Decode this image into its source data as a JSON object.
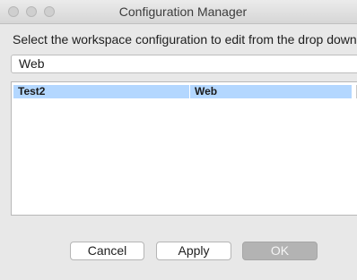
{
  "window": {
    "title": "Configuration Manager"
  },
  "instruction": "Select the workspace configuration to edit from the drop down l",
  "workspace_select": {
    "value": "Web"
  },
  "table": {
    "rows": [
      {
        "col1": "Test2",
        "col2": "Web"
      }
    ]
  },
  "buttons": {
    "cancel": "Cancel",
    "apply": "Apply",
    "ok": "OK"
  }
}
